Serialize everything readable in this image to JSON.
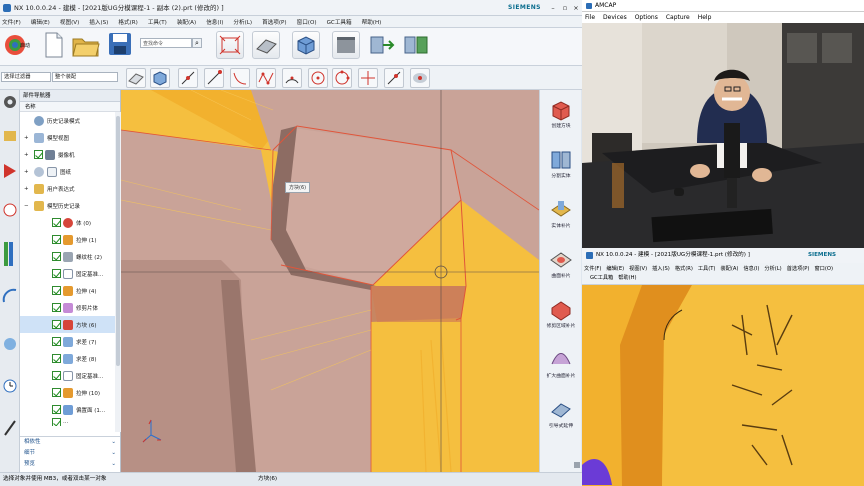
{
  "nx": {
    "title": "NX 10.0.0.24 - 建模 - [2021版UG分模课程-1 - 副本 (2).prt  (修改的) ]",
    "brand": "SIEMENS",
    "menu": [
      "文件(F)",
      "编辑(E)",
      "视图(V)",
      "插入(S)",
      "格式(R)",
      "工具(T)",
      "装配(A)",
      "信息(I)",
      "分析(L)",
      "首选项(P)",
      "窗口(O)",
      "GC工具箱",
      "帮助(H)"
    ],
    "ribbon": {
      "start_label": "启动",
      "search_placeholder": "查找命令"
    },
    "filter": {
      "selection_filter": "选择过滤器",
      "assembly_scope": "整个装配"
    },
    "part_navigator": {
      "title": "部件导航器",
      "column_name": "名称",
      "items": [
        {
          "label": "历史记录模式"
        },
        {
          "label": "模型视图"
        },
        {
          "label": "摄像机"
        },
        {
          "label": "图纸"
        },
        {
          "label": "用户表达式"
        },
        {
          "label": "模型历史记录"
        },
        {
          "label": "体 (0)"
        },
        {
          "label": "拉伸 (1)"
        },
        {
          "label": "螺纹柱 (2)"
        },
        {
          "label": "固定基准..."
        },
        {
          "label": "拉伸 (4)"
        },
        {
          "label": "修剪片体"
        },
        {
          "label": "方块 (6)"
        },
        {
          "label": "求差 (7)"
        },
        {
          "label": "求差 (8)"
        },
        {
          "label": "固定基准..."
        },
        {
          "label": "拉伸 (10)"
        },
        {
          "label": "偏置面 (1..."
        },
        {
          "label": "..."
        }
      ],
      "sections": [
        "相依性",
        "细节",
        "预览"
      ]
    },
    "canvas": {
      "tooltip": "方块(6)"
    },
    "right_tools": [
      {
        "label": "创建方块"
      },
      {
        "label": "分割实体"
      },
      {
        "label": "实体补片"
      },
      {
        "label": "曲面补片"
      },
      {
        "label": "修剪区域补片"
      },
      {
        "label": "扩大曲面补片"
      },
      {
        "label": "引导式延伸"
      }
    ],
    "status": {
      "hint": "选择对象并使用 MB3，或者双击某一对象",
      "selected": "方块(6)"
    }
  },
  "amcap": {
    "title": "AMCAP",
    "menu": [
      "File",
      "Devices",
      "Options",
      "Capture",
      "Help"
    ]
  },
  "nx_small": {
    "title": "NX 10.0.0.24 - 建模 - [2021版UG分模课程-1.prt  (修改的) ]",
    "brand": "SIEMENS",
    "menu": [
      "文件(F)",
      "编辑(E)",
      "视图(V)",
      "插入(S)",
      "格式(R)",
      "工具(T)",
      "装配(A)",
      "信息(I)",
      "分析(L)",
      "首选项(P)",
      "窗口(O)"
    ],
    "menu2": [
      "GC工具箱",
      "帮助(H)"
    ]
  },
  "colors": {
    "model_orange": "#f2b12e",
    "part_rose": "#c9a398",
    "edge_red": "#e0553a",
    "canvas_bg": "#e8eef4"
  }
}
